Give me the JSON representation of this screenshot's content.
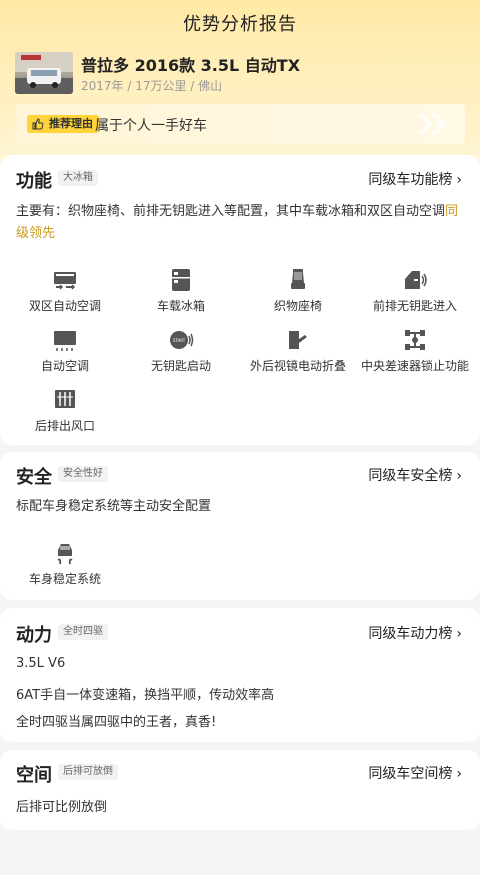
{
  "page": {
    "title": "优势分析报告"
  },
  "car": {
    "name": "普拉多 2016款 3.5L 自动TX",
    "meta": "2017年 / 17万公里 / 佛山"
  },
  "recommend": {
    "tag": "推荐理由",
    "text": "属于个人一手好车"
  },
  "function_section": {
    "title": "功能",
    "badge": "大冰箱",
    "rank": "同级车功能榜",
    "desc_main": "主要有：织物座椅、前排无钥匙进入等配置，其中车载冰箱和双区自动空调",
    "desc_highlight": "同级领先",
    "features": [
      {
        "label": "双区自动空调",
        "icon": "dual-zone-ac-icon"
      },
      {
        "label": "车载冰箱",
        "icon": "fridge-icon"
      },
      {
        "label": "织物座椅",
        "icon": "fabric-seat-icon"
      },
      {
        "label": "前排无钥匙进入",
        "icon": "keyless-entry-icon"
      },
      {
        "label": "自动空调",
        "icon": "auto-ac-icon"
      },
      {
        "label": "无钥匙启动",
        "icon": "keyless-start-icon"
      },
      {
        "label": "外后视镜电动折叠",
        "icon": "mirror-fold-icon"
      },
      {
        "label": "中央差速器锁止功能",
        "icon": "diff-lock-icon"
      },
      {
        "label": "后排出风口",
        "icon": "rear-vent-icon"
      }
    ]
  },
  "safety_section": {
    "title": "安全",
    "badge": "安全性好",
    "rank": "同级车安全榜",
    "desc": "标配车身稳定系统等主动安全配置",
    "features": [
      {
        "label": "车身稳定系统",
        "icon": "stability-control-icon"
      }
    ]
  },
  "power_section": {
    "title": "动力",
    "badge": "全时四驱",
    "rank": "同级车动力榜",
    "lines": [
      "3.5L V6",
      "6AT手自一体变速箱，换挡平顺，传动效率高",
      "全时四驱当属四驱中的王者，真香!"
    ]
  },
  "space_section": {
    "title": "空间",
    "badge": "后排可放倒",
    "rank": "同级车空间榜",
    "desc": "后排可比例放倒"
  },
  "colors": {
    "accent": "#ffd33a",
    "highlight": "#c99a1c",
    "hero_bg": "#ffe9a6"
  }
}
